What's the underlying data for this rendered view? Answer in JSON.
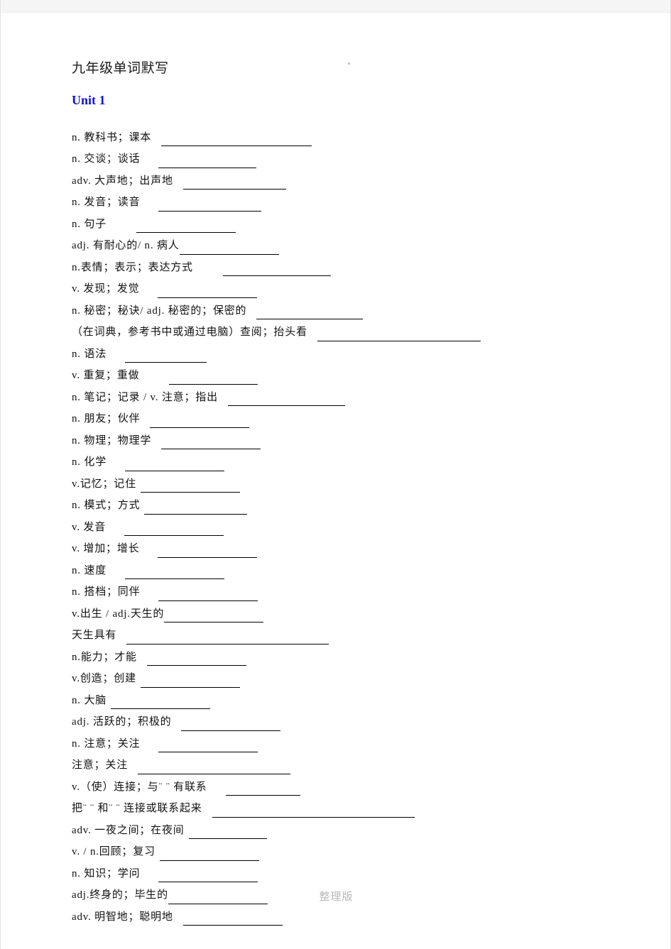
{
  "document": {
    "title": "九年级单词默写",
    "unit_heading": "Unit 1",
    "footer_note": "整理版"
  },
  "entries": [
    {
      "definition": "n.  教科书；课本",
      "gap": "md",
      "blank_width": 212
    },
    {
      "definition": "n.  交谈；谈话",
      "gap": "lg",
      "blank_width": 138
    },
    {
      "definition": "adv.  大声地；出声地",
      "gap": "md",
      "blank_width": 145
    },
    {
      "definition": "n.  发音；读音",
      "gap": "lg",
      "blank_width": 145
    },
    {
      "definition": "n.  句子",
      "gap": "xl",
      "blank_width": 140
    },
    {
      "definition": "adj.  有耐心的/ n.  病人",
      "gap": "none",
      "blank_width": 140
    },
    {
      "definition": "n.表情；表示；表达方式",
      "gap": "xl",
      "blank_width": 152
    },
    {
      "definition": "v.  发现；发觉",
      "gap": "lg",
      "blank_width": 140
    },
    {
      "definition": "n.  秘密；秘诀/ adj.  秘密的；保密的",
      "gap": "md",
      "blank_width": 150
    },
    {
      "definition": "（在词典，参考书中或通过电脑）查阅；抬头看",
      "gap": "md",
      "blank_width": 230
    },
    {
      "definition": "n.  语法",
      "gap": "lg",
      "blank_width": 115
    },
    {
      "definition": "v.  重复；重做",
      "gap": "xl",
      "blank_width": 125
    },
    {
      "definition": "n.  笔记；记录 / v.  注意；指出",
      "gap": "md",
      "blank_width": 165
    },
    {
      "definition": "n.  朋友；伙伴",
      "gap": "md",
      "blank_width": 140
    },
    {
      "definition": "n.  物理；物理学",
      "gap": "md",
      "blank_width": 140
    },
    {
      "definition": "n.  化学",
      "gap": "lg",
      "blank_width": 140
    },
    {
      "definition": "v.记忆；记住",
      "gap": "sm",
      "blank_width": 140
    },
    {
      "definition": "n.  模式；方式",
      "gap": "sm",
      "blank_width": 145
    },
    {
      "definition": "v.  发音",
      "gap": "lg",
      "blank_width": 140
    },
    {
      "definition": "v.  增加；增长",
      "gap": "lg",
      "blank_width": 140
    },
    {
      "definition": "n.  速度",
      "gap": "lg",
      "blank_width": 140
    },
    {
      "definition": "n.  搭档；同伴",
      "gap": "lg",
      "blank_width": 140
    },
    {
      "definition": "v.出生 / adj.天生的",
      "gap": "none",
      "blank_width": 140
    },
    {
      "definition": "天生具有",
      "gap": "md",
      "blank_width": 285
    },
    {
      "definition": "n.能力；才能",
      "gap": "md",
      "blank_width": 140
    },
    {
      "definition": "v.创造；创建",
      "gap": "sm",
      "blank_width": 140
    },
    {
      "definition": "n.  大脑",
      "gap": "sm",
      "blank_width": 140
    },
    {
      "definition": "adj.  活跃的；积极的",
      "gap": "md",
      "blank_width": 140
    },
    {
      "definition": "n.  注意；关注",
      "gap": "lg",
      "blank_width": 140
    },
    {
      "definition": "注意；关注",
      "gap": "md",
      "blank_width": 215
    },
    {
      "definition": "v.（使）连接；与¨ ¨ 有联系",
      "gap": "lg",
      "blank_width": 105
    },
    {
      "definition": "把¨ ¨ 和¨ ¨ 连接或联系起来",
      "gap": "md",
      "blank_width": 285
    },
    {
      "definition": "adv.  一夜之间；在夜间",
      "gap": "sm",
      "blank_width": 110
    },
    {
      "definition": "v. / n.回顾；复习",
      "gap": "sm",
      "blank_width": 140
    },
    {
      "definition": "n.  知识；学问",
      "gap": "lg",
      "blank_width": 140
    },
    {
      "definition": "adj.终身的；毕生的",
      "gap": "none",
      "blank_width": 140
    },
    {
      "definition": "adv.  明智地；聪明地",
      "gap": "md",
      "blank_width": 140
    }
  ]
}
